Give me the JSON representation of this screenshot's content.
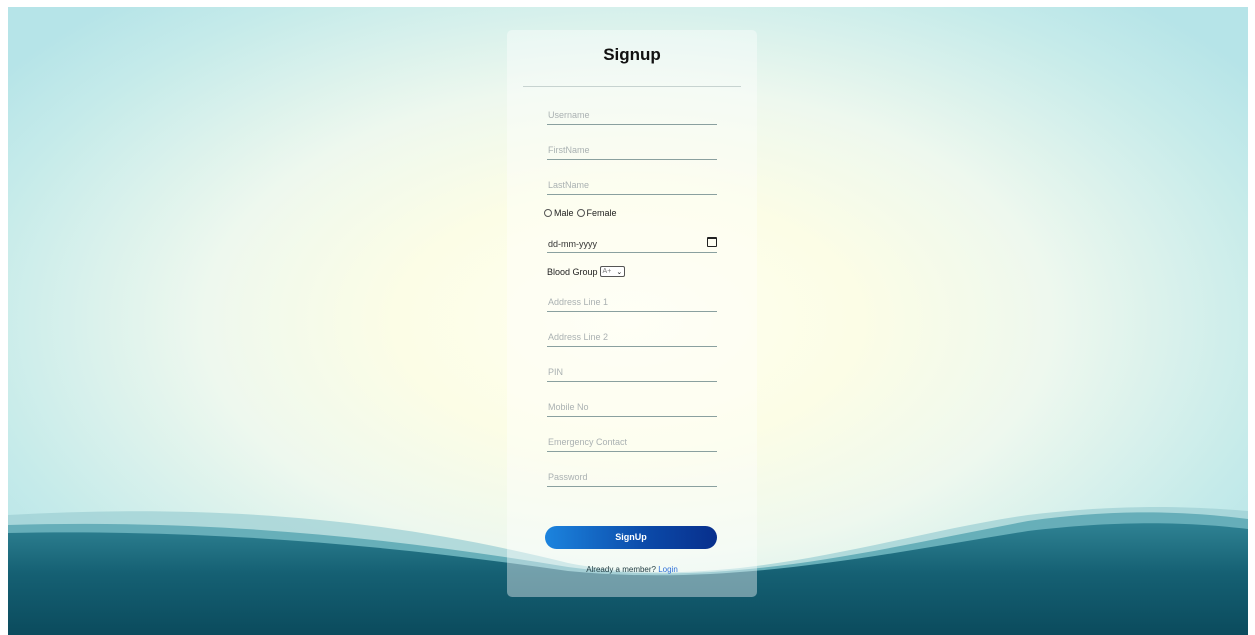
{
  "form": {
    "title": "Signup",
    "fields": {
      "username": {
        "placeholder": "Username"
      },
      "firstname": {
        "placeholder": "FirstName"
      },
      "lastname": {
        "placeholder": "LastName"
      },
      "dob": {
        "placeholder": "dd-mm-yyyy"
      },
      "address1": {
        "placeholder": "Address Line 1"
      },
      "address2": {
        "placeholder": "Address Line 2"
      },
      "pin": {
        "placeholder": "PIN"
      },
      "mobile": {
        "placeholder": "Mobile No"
      },
      "emergency": {
        "placeholder": "Emergency Contact"
      },
      "password": {
        "placeholder": "Password"
      }
    },
    "gender": {
      "male_label": "Male",
      "female_label": "Female"
    },
    "blood_group": {
      "label": "Blood Group",
      "selected": "A+"
    },
    "submit_label": "SignUp",
    "member_text": "Already a member?",
    "login_label": "Login"
  },
  "colors": {
    "button_start": "#1c84de",
    "button_end": "#082f8c",
    "wave_dark": "#0c4a5c",
    "wave_light": "#2a7f90",
    "link": "#2e6fd8"
  },
  "icons": {
    "calendar": "calendar-icon",
    "dropdown": "chevron-down-icon"
  }
}
